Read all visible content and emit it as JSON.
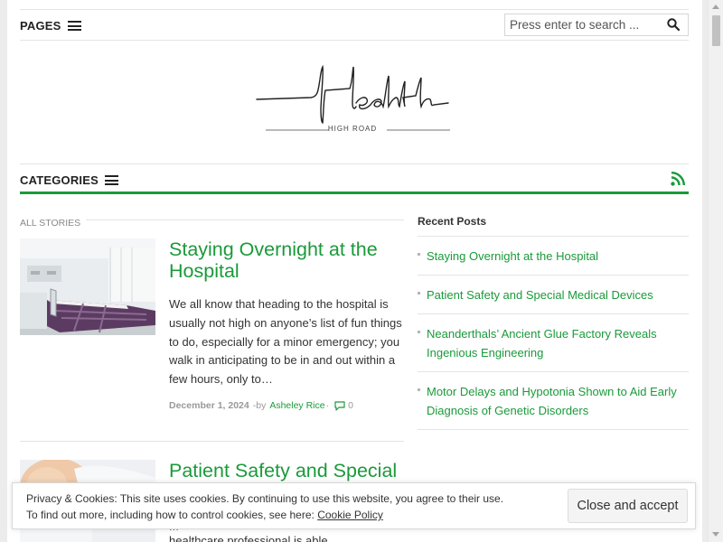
{
  "header": {
    "pages_label": "PAGES",
    "search_placeholder": "Press enter to search ...",
    "logo_sub": "HIGH ROAD",
    "logo_wordmark": "Health",
    "categories_label": "CATEGORIES"
  },
  "main": {
    "section_title": "ALL STORIES",
    "posts": [
      {
        "title": "Staying Overnight at the Hospital",
        "excerpt": "We all know that heading to the hospital is usually not high on anyone’s list of fun things to do, especially for a minor emergency; you walk in anticipating to be in and out within a few hours, only to…",
        "date": "December 1, 2024",
        "by": "-by",
        "author": "Asheley Rice",
        "comments": "0"
      },
      {
        "title": "Patient Safety and Special Medical Devices",
        "excerpt_fragment_1": "...",
        "excerpt_fragment_2": "healthcare professional is able"
      }
    ]
  },
  "sidebar": {
    "title": "Recent Posts",
    "items": [
      "Staying Overnight at the Hospital",
      "Patient Safety and Special Medical Devices",
      "Neanderthals’ Ancient Glue Factory Reveals Ingenious Engineering",
      "Motor Delays and Hypotonia Shown to Aid Early Diagnosis of Genetic Disorders"
    ]
  },
  "cookie": {
    "line1": "Privacy & Cookies: This site uses cookies. By continuing to use this website, you agree to their use.",
    "line2": "To find out more, including how to control cookies, see here:",
    "link": "Cookie Policy",
    "button": "Close and accept"
  },
  "colors": {
    "accent": "#1a9a3a",
    "rss": "#1a9a3a"
  },
  "icons": {
    "menu": "hamburger-icon",
    "search": "search-icon",
    "rss": "rss-icon",
    "comment": "comment-icon"
  }
}
